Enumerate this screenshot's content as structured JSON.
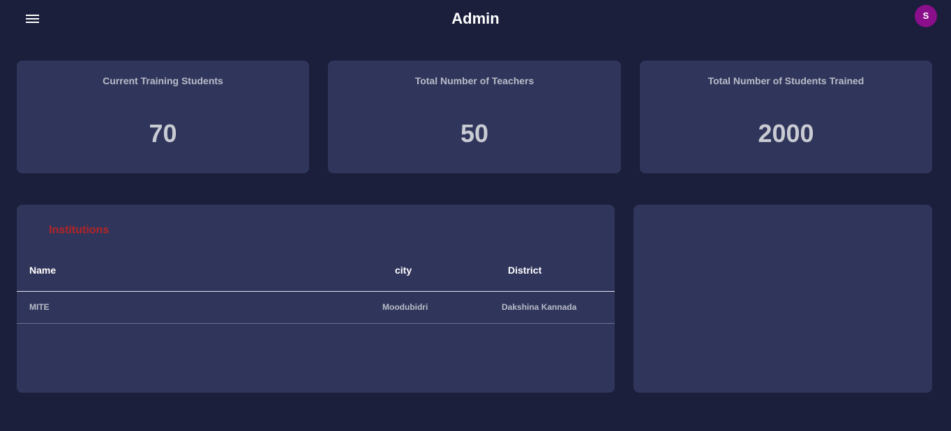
{
  "header": {
    "title": "Admin",
    "avatar_initial": "S",
    "menu_icon": "hamburger-menu-icon"
  },
  "stats": [
    {
      "label": "Current Training Students",
      "value": "70"
    },
    {
      "label": "Total Number of Teachers",
      "value": "50"
    },
    {
      "label": "Total Number of Students Trained",
      "value": "2000"
    }
  ],
  "institutions": {
    "title": "Institutions",
    "columns": [
      "Name",
      "city",
      "District"
    ],
    "rows": [
      [
        "MITE",
        "Moodubidri",
        "Dakshina Kannada"
      ]
    ]
  },
  "colors": {
    "background": "#1b1f3b",
    "card": "#30355b",
    "accent_title": "#b32525",
    "avatar": "#8b0e8b"
  }
}
